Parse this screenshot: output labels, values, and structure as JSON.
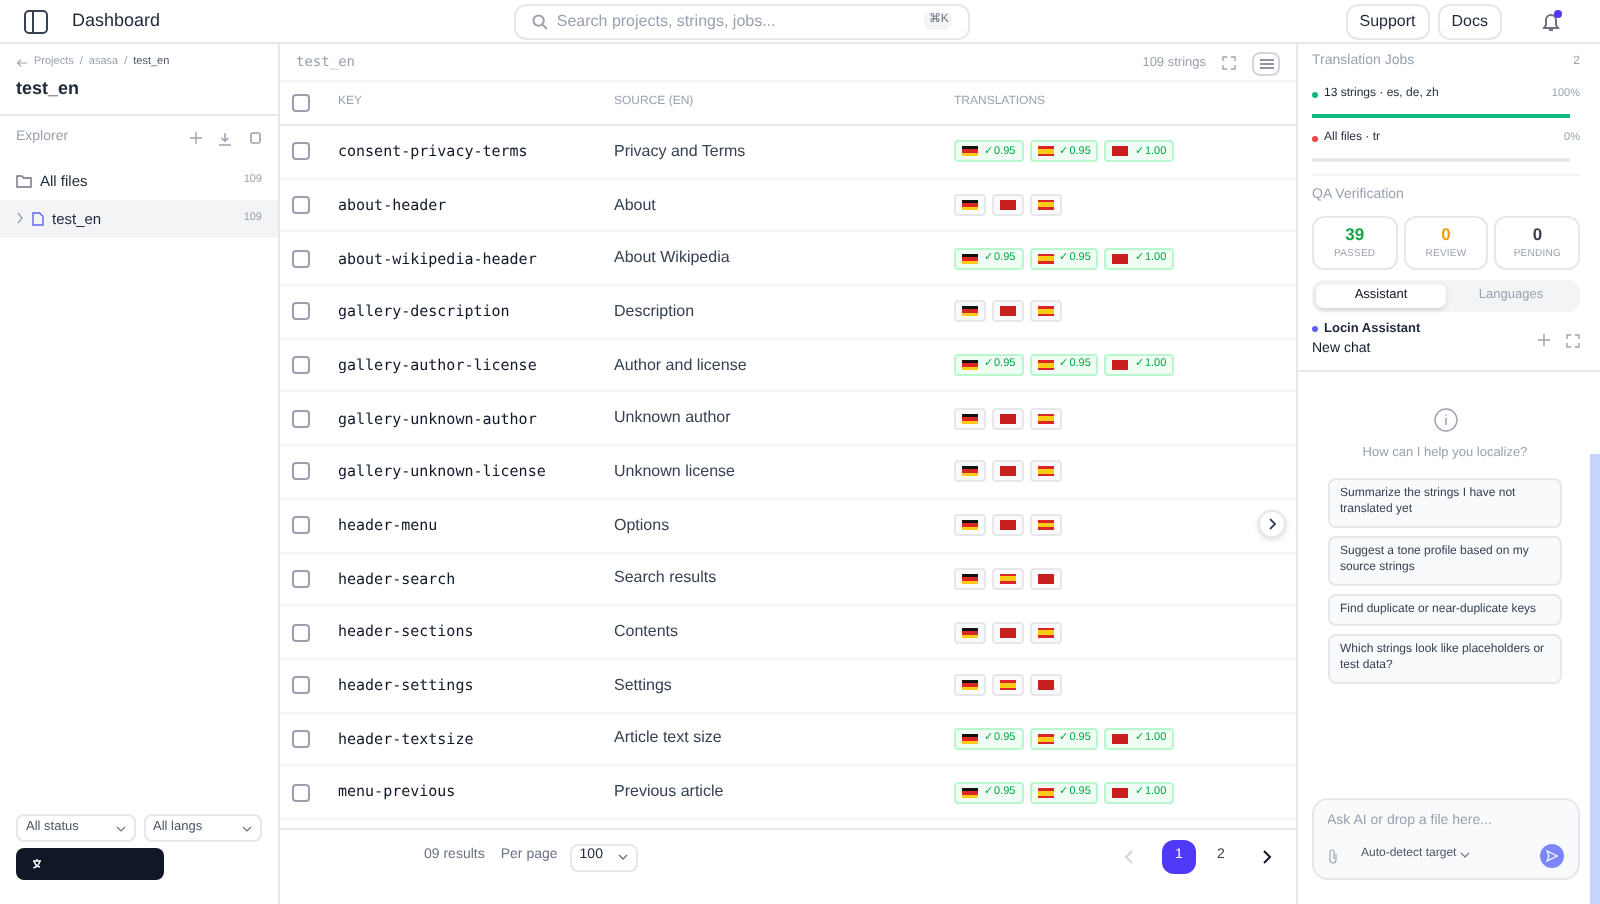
{
  "topbar": {
    "title": "Dashboard",
    "search": {
      "placeholder": "Search projects, strings, jobs...",
      "shortcut": "⌘K"
    },
    "buttons": [
      "Support",
      "Docs"
    ],
    "notification": true
  },
  "sidebar": {
    "breadcrumb": [
      "Projects",
      "asasa",
      "test_en"
    ],
    "breadcrumb_separator": "/",
    "title": "test_en",
    "section": "Explorer",
    "items": [
      {
        "kind": "folder",
        "label": "All files",
        "count": "109",
        "selected": false
      },
      {
        "kind": "file",
        "label": "test_en",
        "count": "109",
        "selected": true
      }
    ],
    "filters": [
      "All status",
      "All langs"
    ]
  },
  "table": {
    "file": "test_en",
    "count": "109 strings",
    "select_all": false,
    "columns": [
      "KEY",
      "SOURCE (EN)",
      "TRANSLATIONS"
    ],
    "rows": [
      {
        "key": "consent-privacy-terms",
        "source": "Privacy and Terms",
        "checked": false,
        "translations": [
          {
            "kind": "de",
            "score": "✓0.95"
          },
          {
            "kind": "es",
            "score": "✓0.95"
          },
          {
            "kind": "tr",
            "score": "✓1.00"
          }
        ]
      },
      {
        "key": "about-header",
        "source": "About",
        "checked": false,
        "translations": [
          {
            "kind": "de"
          },
          {
            "kind": "tr"
          },
          {
            "kind": "es"
          }
        ]
      },
      {
        "key": "about-wikipedia-header",
        "source": "About Wikipedia",
        "checked": false,
        "translations": [
          {
            "kind": "de",
            "score": "✓0.95"
          },
          {
            "kind": "es",
            "score": "✓0.95"
          },
          {
            "kind": "tr",
            "score": "✓1.00"
          }
        ]
      },
      {
        "key": "gallery-description",
        "source": "Description",
        "checked": false,
        "translations": [
          {
            "kind": "de"
          },
          {
            "kind": "tr"
          },
          {
            "kind": "es"
          }
        ]
      },
      {
        "key": "gallery-author-license",
        "source": "Author and license",
        "checked": false,
        "translations": [
          {
            "kind": "de",
            "score": "✓0.95"
          },
          {
            "kind": "es",
            "score": "✓0.95"
          },
          {
            "kind": "tr",
            "score": "✓1.00"
          }
        ]
      },
      {
        "key": "gallery-unknown-author",
        "source": "Unknown author",
        "checked": false,
        "translations": [
          {
            "kind": "de"
          },
          {
            "kind": "tr"
          },
          {
            "kind": "es"
          }
        ]
      },
      {
        "key": "gallery-unknown-license",
        "source": "Unknown license",
        "checked": false,
        "translations": [
          {
            "kind": "de"
          },
          {
            "kind": "tr"
          },
          {
            "kind": "es"
          }
        ]
      },
      {
        "key": "header-menu",
        "source": "Options",
        "checked": false,
        "translations": [
          {
            "kind": "de"
          },
          {
            "kind": "tr"
          },
          {
            "kind": "es"
          }
        ]
      },
      {
        "key": "header-search",
        "source": "Search results",
        "checked": false,
        "translations": [
          {
            "kind": "de"
          },
          {
            "kind": "es"
          },
          {
            "kind": "tr"
          }
        ]
      },
      {
        "key": "header-sections",
        "source": "Contents",
        "checked": false,
        "translations": [
          {
            "kind": "de"
          },
          {
            "kind": "tr"
          },
          {
            "kind": "es"
          }
        ]
      },
      {
        "key": "header-settings",
        "source": "Settings",
        "checked": false,
        "translations": [
          {
            "kind": "de"
          },
          {
            "kind": "es"
          },
          {
            "kind": "tr"
          }
        ]
      },
      {
        "key": "header-textsize",
        "source": "Article text size",
        "checked": false,
        "translations": [
          {
            "kind": "de",
            "score": "✓0.95"
          },
          {
            "kind": "es",
            "score": "✓0.95"
          },
          {
            "kind": "tr",
            "score": "✓1.00"
          }
        ]
      },
      {
        "key": "menu-previous",
        "source": "Previous article",
        "checked": false,
        "translations": [
          {
            "kind": "de",
            "score": "✓0.95"
          },
          {
            "kind": "es",
            "score": "✓0.95"
          },
          {
            "kind": "tr",
            "score": "✓1.00"
          }
        ]
      }
    ]
  },
  "footer": {
    "results": "09 results",
    "per_page_label": "Per page",
    "per_page": "100",
    "pages": [
      {
        "label": "1",
        "selected": true
      },
      {
        "label": "2",
        "selected": false
      }
    ]
  },
  "right": {
    "jobs_title": "Translation Jobs",
    "jobs_count": "2",
    "jobs": [
      {
        "label": "13 strings · es, de, zh",
        "percent": "100%",
        "level": 1,
        "color": "#10b981"
      },
      {
        "label": "All files · tr",
        "percent": "0%",
        "level": 0,
        "color": "#ef4444"
      }
    ],
    "qa_title": "QA Verification",
    "qa": [
      {
        "value": "39",
        "label": "PASSED",
        "color": "#16a34a"
      },
      {
        "value": "0",
        "label": "REVIEW",
        "color": "#f59e0b"
      },
      {
        "value": "0",
        "label": "PENDING",
        "color": "#374151"
      }
    ],
    "tabs": [
      {
        "label": "Assistant",
        "selected": true
      },
      {
        "label": "Languages",
        "selected": false
      }
    ],
    "assistant": {
      "name": "Locin Assistant",
      "chat": "New chat",
      "prompt": "How can I help you localize?",
      "suggestions": [
        "Summarize the strings I have not translated yet",
        "Suggest a tone profile based on my source strings",
        "Find duplicate or near-duplicate keys",
        "Which strings look like placeholders or test data?"
      ],
      "input_placeholder": "Ask AI or drop a file here...",
      "target": "Auto-detect target"
    }
  }
}
